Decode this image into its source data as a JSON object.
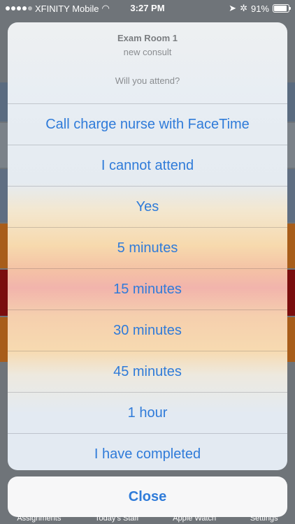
{
  "status_bar": {
    "carrier": "XFINITY Mobile",
    "time": "3:27 PM",
    "battery": "91%"
  },
  "alert": {
    "title": "Exam Room 1",
    "subtitle": "new consult",
    "message": "Will you attend?",
    "actions": [
      "Call charge nurse with FaceTime",
      "I cannot attend",
      "Yes",
      "5 minutes",
      "15 minutes",
      "30 minutes",
      "45 minutes",
      "1 hour",
      "I have completed"
    ],
    "close_label": "Close"
  },
  "tab_bar": {
    "items": [
      "Assignments",
      "Today's Staff",
      "Apple Watch",
      "Settings"
    ]
  },
  "colors": {
    "accent": "#2f7bd9",
    "backdrop": "#6f7479"
  }
}
